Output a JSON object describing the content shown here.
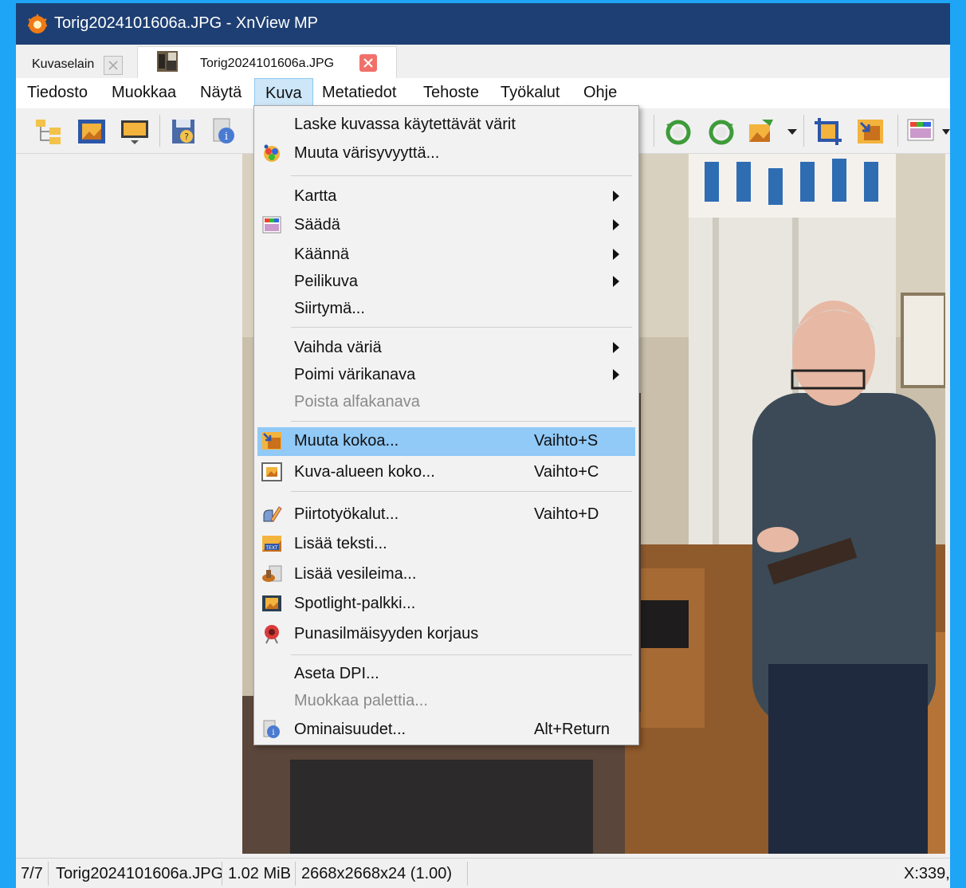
{
  "window": {
    "title": "Torig2024101606a.JPG - XnView MP"
  },
  "tabs": [
    {
      "label": "Kuvaselain"
    },
    {
      "label": "Torig2024101606a.JPG"
    }
  ],
  "menubar": [
    "Tiedosto",
    "Muokkaa",
    "Näytä",
    "Kuva",
    "Metatiedot",
    "Tehoste",
    "Työkalut",
    "Ohje"
  ],
  "dropdown": {
    "items": [
      {
        "label": "Laske kuvassa käytettävät värit"
      },
      {
        "label": "Muuta värisyvyyttä..."
      },
      {
        "label": "Kartta"
      },
      {
        "label": "Säädä"
      },
      {
        "label": "Käännä"
      },
      {
        "label": "Peilikuva"
      },
      {
        "label": "Siirtymä..."
      },
      {
        "label": "Vaihda väriä"
      },
      {
        "label": "Poimi värikanava"
      },
      {
        "label": "Poista alfakanava"
      },
      {
        "label": "Muuta kokoa...",
        "shortcut": "Vaihto+S"
      },
      {
        "label": "Kuva-alueen koko...",
        "shortcut": "Vaihto+C"
      },
      {
        "label": "Piirtotyökalut...",
        "shortcut": "Vaihto+D"
      },
      {
        "label": "Lisää teksti..."
      },
      {
        "label": "Lisää vesileima..."
      },
      {
        "label": "Spotlight-palkki..."
      },
      {
        "label": "Punasilmäisyyden korjaus"
      },
      {
        "label": "Aseta DPI..."
      },
      {
        "label": "Muokkaa palettia..."
      },
      {
        "label": "Ominaisuudet...",
        "shortcut": "Alt+Return"
      }
    ]
  },
  "statusbar": {
    "position": "7/7",
    "filename": "Torig2024101606a.JPG",
    "filesize": "1.02 MiB",
    "dimensions": "2668x2668x24 (1.00)",
    "coords": "X:339,"
  },
  "colors": {
    "desktop": "#1ea5f5",
    "titlebar": "#1e3f73",
    "menu_highlight": "#91c9f7"
  }
}
